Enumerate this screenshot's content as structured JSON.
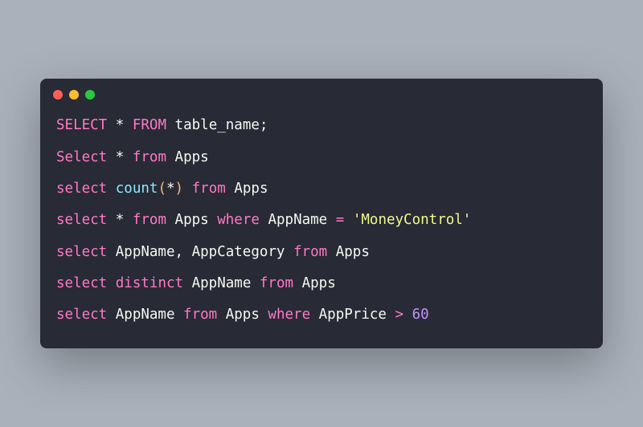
{
  "window": {
    "traffic_lights": [
      "red",
      "yellow",
      "green"
    ]
  },
  "code": {
    "lines": [
      [
        {
          "t": "SELECT",
          "c": "kw"
        },
        {
          "t": " ",
          "c": "id"
        },
        {
          "t": "*",
          "c": "star"
        },
        {
          "t": " ",
          "c": "id"
        },
        {
          "t": "FROM",
          "c": "kw"
        },
        {
          "t": " table_name;",
          "c": "id"
        }
      ],
      [
        {
          "t": "Select",
          "c": "kw"
        },
        {
          "t": " ",
          "c": "id"
        },
        {
          "t": "*",
          "c": "star"
        },
        {
          "t": " ",
          "c": "id"
        },
        {
          "t": "from",
          "c": "kw"
        },
        {
          "t": " Apps",
          "c": "id"
        }
      ],
      [
        {
          "t": "select",
          "c": "kw"
        },
        {
          "t": " ",
          "c": "id"
        },
        {
          "t": "count",
          "c": "fn"
        },
        {
          "t": "(",
          "c": "paren"
        },
        {
          "t": "*",
          "c": "star"
        },
        {
          "t": ")",
          "c": "paren"
        },
        {
          "t": " ",
          "c": "id"
        },
        {
          "t": "from",
          "c": "kw"
        },
        {
          "t": " Apps",
          "c": "id"
        }
      ],
      [
        {
          "t": "select",
          "c": "kw"
        },
        {
          "t": " ",
          "c": "id"
        },
        {
          "t": "*",
          "c": "star"
        },
        {
          "t": " ",
          "c": "id"
        },
        {
          "t": "from",
          "c": "kw"
        },
        {
          "t": " Apps ",
          "c": "id"
        },
        {
          "t": "where",
          "c": "kw"
        },
        {
          "t": " AppName ",
          "c": "id"
        },
        {
          "t": "=",
          "c": "kw"
        },
        {
          "t": " ",
          "c": "id"
        },
        {
          "t": "'MoneyControl'",
          "c": "str"
        }
      ],
      [
        {
          "t": "select",
          "c": "kw"
        },
        {
          "t": " AppName, AppCategory ",
          "c": "id"
        },
        {
          "t": "from",
          "c": "kw"
        },
        {
          "t": " Apps",
          "c": "id"
        }
      ],
      [
        {
          "t": "select",
          "c": "kw"
        },
        {
          "t": " ",
          "c": "id"
        },
        {
          "t": "distinct",
          "c": "kw"
        },
        {
          "t": " AppName ",
          "c": "id"
        },
        {
          "t": "from",
          "c": "kw"
        },
        {
          "t": " Apps",
          "c": "id"
        }
      ],
      [
        {
          "t": "select",
          "c": "kw"
        },
        {
          "t": " AppName ",
          "c": "id"
        },
        {
          "t": "from",
          "c": "kw"
        },
        {
          "t": " Apps ",
          "c": "id"
        },
        {
          "t": "where",
          "c": "kw"
        },
        {
          "t": " AppPrice ",
          "c": "id"
        },
        {
          "t": ">",
          "c": "kw"
        },
        {
          "t": " ",
          "c": "id"
        },
        {
          "t": "60",
          "c": "num"
        }
      ]
    ]
  }
}
